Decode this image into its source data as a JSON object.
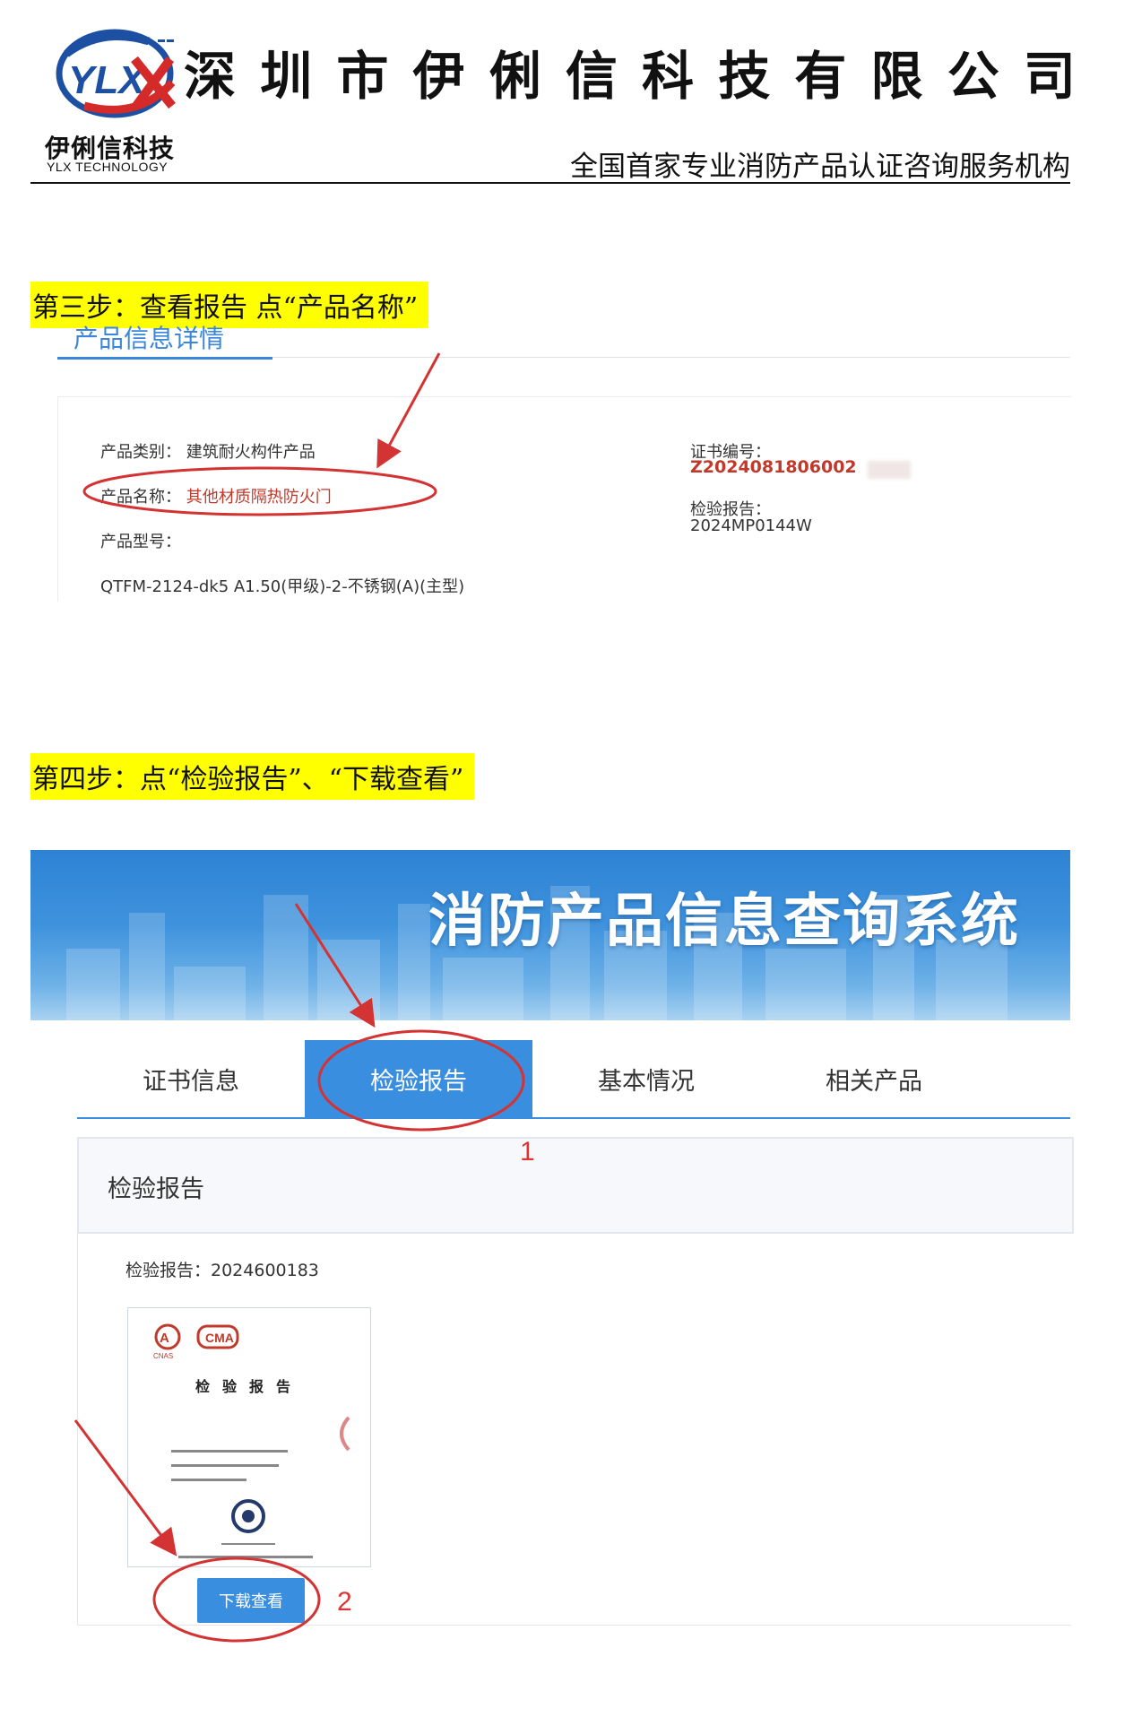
{
  "header": {
    "logo_cn": "伊俐信科技",
    "logo_en": "YLX TECHNOLOGY",
    "logo_mark_text": "YLX",
    "company_chars": [
      "深",
      "圳",
      "市",
      "伊",
      "俐",
      "信",
      "科",
      "技",
      "有",
      "限",
      "公",
      "司"
    ],
    "tagline": "全国首家专业消防产品认证咨询服务机构"
  },
  "step3": {
    "label": "第三步：查看报告 点“产品名称”"
  },
  "product_info": {
    "title": "产品信息详情",
    "category_label": "产品类别：",
    "category_value": "建筑耐火构件产品",
    "name_label": "产品名称：",
    "name_value": "其他材质隔热防火门",
    "model_label": "产品型号：",
    "model_value": "QTFM-2124-dk5 A1.50(甲级)-2-不锈钢(A)(主型)",
    "cert_label": "证书编号：",
    "cert_value": "Z2024081806002",
    "report_label": "检验报告：",
    "report_value": "2024MP0144W"
  },
  "step4": {
    "label": "第四步：点“检验报告”、“下载查看”"
  },
  "system": {
    "banner_title": "消防产品信息查询系统",
    "tabs": [
      {
        "label": "证书信息",
        "active": false
      },
      {
        "label": "检验报告",
        "active": true
      },
      {
        "label": "基本情况",
        "active": false
      },
      {
        "label": "相关产品",
        "active": false
      }
    ],
    "section_title": "检验报告",
    "report_no": "检验报告：2024600183",
    "thumb_title": "检验报告",
    "thumb_marks": [
      "CNAS",
      "CMA"
    ],
    "download_label": "下载查看"
  },
  "annotations": {
    "num1": "1",
    "num2": "2",
    "color": "#d33333"
  }
}
